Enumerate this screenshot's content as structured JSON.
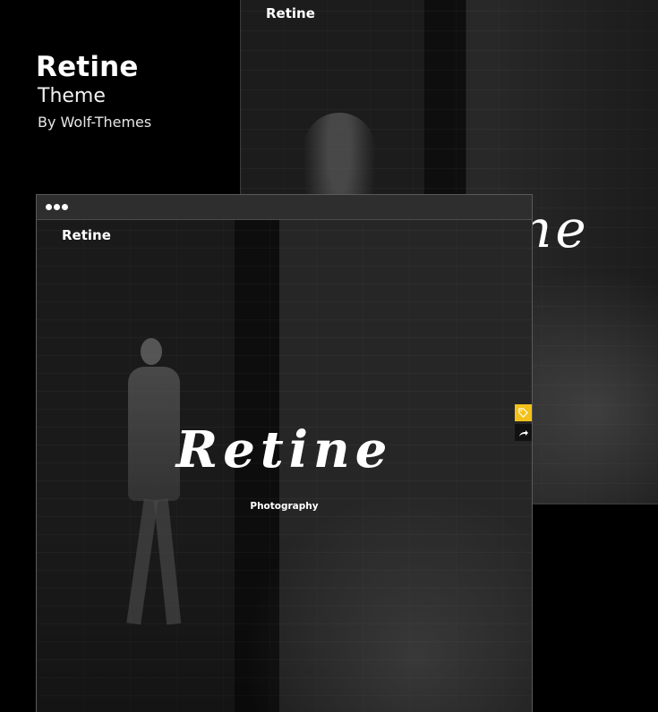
{
  "header": {
    "title": "Retine",
    "subtitle": "Theme",
    "author": "By Wolf-Themes"
  },
  "background_preview": {
    "logo": "Retine",
    "script_text": "ne"
  },
  "front_window": {
    "logo": "Retine",
    "hero_title": "Retine",
    "hero_subtitle": "Photography",
    "tools": {
      "tag_icon": "tag-icon",
      "share_icon": "share-icon"
    },
    "scroll_top_icon": "arrow-up-icon"
  },
  "colors": {
    "background": "#000000",
    "accent": "#f2c21b"
  }
}
